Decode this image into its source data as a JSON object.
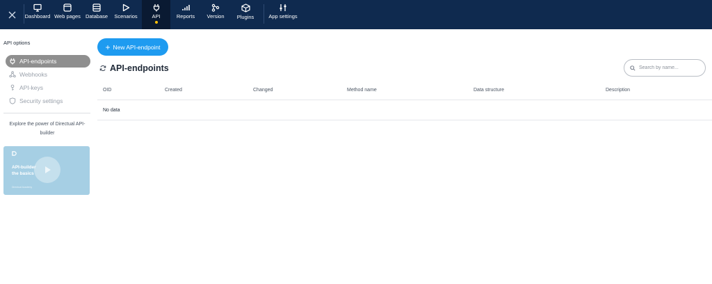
{
  "nav": {
    "items": [
      {
        "label": "Dashboard",
        "icon": "dashboard-icon"
      },
      {
        "label": "Web pages",
        "icon": "web-pages-icon"
      },
      {
        "label": "Database",
        "icon": "database-icon"
      },
      {
        "label": "Scenarios",
        "icon": "scenarios-icon"
      },
      {
        "label": "API",
        "icon": "api-plug-icon",
        "active": true
      },
      {
        "label": "Reports",
        "icon": "reports-icon"
      },
      {
        "label": "Version",
        "icon": "version-icon"
      },
      {
        "label": "Plugins",
        "icon": "plugins-icon"
      },
      {
        "label": "App settings",
        "icon": "app-settings-icon"
      }
    ],
    "colors": {
      "background": "#0f2a4f",
      "active_background": "#0a1a32",
      "active_dot": "#ffc107"
    }
  },
  "sidebar": {
    "title": "API options",
    "items": [
      {
        "label": "API-endpoints",
        "icon": "plug-icon",
        "active": true
      },
      {
        "label": "Webhooks",
        "icon": "webhooks-icon"
      },
      {
        "label": "API-keys",
        "icon": "key-icon"
      },
      {
        "label": "Security settings",
        "icon": "shield-icon"
      }
    ],
    "explore_text": "Explore the power of Directual API-builder",
    "video": {
      "title_line1": "API-builder",
      "title_line2": "the basics",
      "footer": "Directual Academy"
    }
  },
  "main": {
    "new_button_label": "New API-endpoint",
    "title": "API-endpoints",
    "search_placeholder": "Search by name...",
    "columns": [
      "OID",
      "Created",
      "Changed",
      "Method name",
      "Data structure",
      "Description"
    ],
    "empty_text": "No data",
    "accent": "#1e9bf0"
  }
}
